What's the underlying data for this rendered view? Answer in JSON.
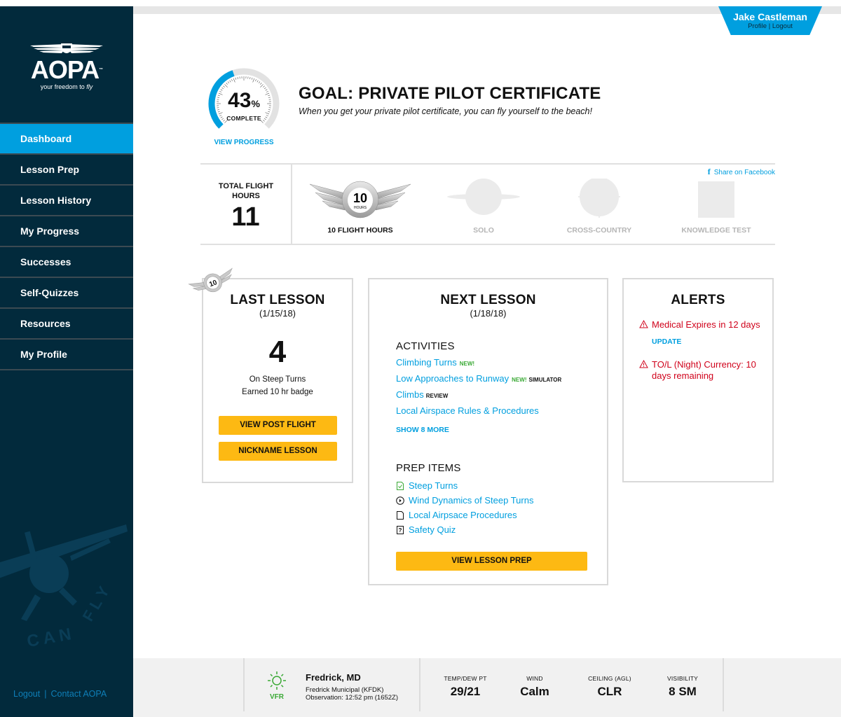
{
  "brand": {
    "name": "AOPA",
    "tagline_prefix": "your freedom to ",
    "tagline_em": "fly"
  },
  "user": {
    "name": "Jake Castleman",
    "profile": "Profile",
    "separator": "|",
    "logout": "Logout"
  },
  "sidebar": {
    "items": [
      {
        "label": "Dashboard",
        "active": true
      },
      {
        "label": "Lesson Prep"
      },
      {
        "label": "Lesson History"
      },
      {
        "label": "My Progress"
      },
      {
        "label": "Successes"
      },
      {
        "label": "Self-Quizzes"
      },
      {
        "label": "Resources"
      },
      {
        "label": "My Profile"
      }
    ],
    "footer": {
      "logout": "Logout",
      "separator": "|",
      "contact": "Contact AOPA"
    }
  },
  "goal": {
    "percent": 43,
    "percent_label": "43",
    "percent_sign": "%",
    "complete_label": "COMPLETE",
    "view_progress": "VIEW PROGRESS",
    "title": "GOAL: PRIVATE PILOT CERTIFICATE",
    "subtitle": "When you get your private pilot certificate, you can fly yourself to the beach!"
  },
  "milestones": {
    "total_label": "TOTAL FLIGHT HOURS",
    "total_value": "11",
    "share": "Share on Facebook",
    "badges": [
      {
        "name": "10 FLIGHT HOURS",
        "earned": true,
        "badge_number": "10",
        "badge_unit": "HOURS"
      },
      {
        "name": "SOLO",
        "earned": false
      },
      {
        "name": "CROSS-COUNTRY",
        "earned": false
      },
      {
        "name": "KNOWLEDGE TEST",
        "earned": false
      }
    ]
  },
  "last_lesson": {
    "title": "LAST LESSON",
    "date": "(1/15/18)",
    "score": "4",
    "line1": "On Steep Turns",
    "line2": "Earned 10 hr badge",
    "btn_post_flight": "VIEW POST FLIGHT",
    "btn_nickname": "NICKNAME LESSON"
  },
  "next_lesson": {
    "title": "NEXT LESSON",
    "date": "(1/18/18)",
    "activities_title": "ACTIVITIES",
    "activities": [
      {
        "label": "Climbing Turns",
        "tags": [
          {
            "text": "NEW!",
            "type": "new"
          }
        ]
      },
      {
        "label": "Low Approaches to Runway",
        "tags": [
          {
            "text": "NEW!",
            "type": "new"
          },
          {
            "text": "SIMULATOR",
            "type": "dark"
          }
        ]
      },
      {
        "label": "Climbs",
        "tags": [
          {
            "text": "REVIEW",
            "type": "dark"
          }
        ]
      },
      {
        "label": "Local Airspace Rules & Procedures",
        "tags": []
      }
    ],
    "show_more": "SHOW 8 MORE",
    "prep_title": "PREP ITEMS",
    "prep_items": [
      {
        "label": "Steep Turns",
        "icon": "checked-doc-icon"
      },
      {
        "label": "Wind Dynamics of Steep Turns",
        "icon": "play-circle-icon"
      },
      {
        "label": "Local Airpsace Procedures",
        "icon": "document-icon"
      },
      {
        "label": "Safety Quiz",
        "icon": "quiz-icon"
      }
    ],
    "btn_prep": "VIEW LESSON PREP"
  },
  "alerts": {
    "title": "ALERTS",
    "items": [
      {
        "text": "Medical Expires in 12 days",
        "action": "UPDATE"
      },
      {
        "text": "TO/L (Night) Currency: 10 days remaining"
      }
    ]
  },
  "weather": {
    "condition": "VFR",
    "city": "Fredrick, MD",
    "station": "Fredrick Municipal (KFDK)",
    "observation": "Observation: 12:52 pm (1652Z)",
    "stats": [
      {
        "label": "TEMP/DEW PT",
        "value": "29/21"
      },
      {
        "label": "WIND",
        "value": "Calm"
      },
      {
        "label": "CEILING (AGL)",
        "value": "CLR"
      },
      {
        "label": "VISIBILITY",
        "value": "8 SM"
      }
    ]
  },
  "colors": {
    "accent": "#009fdf",
    "sidebar": "#022a3c",
    "button": "#fdb913",
    "alert": "#d0021b",
    "new": "#3aa935"
  }
}
